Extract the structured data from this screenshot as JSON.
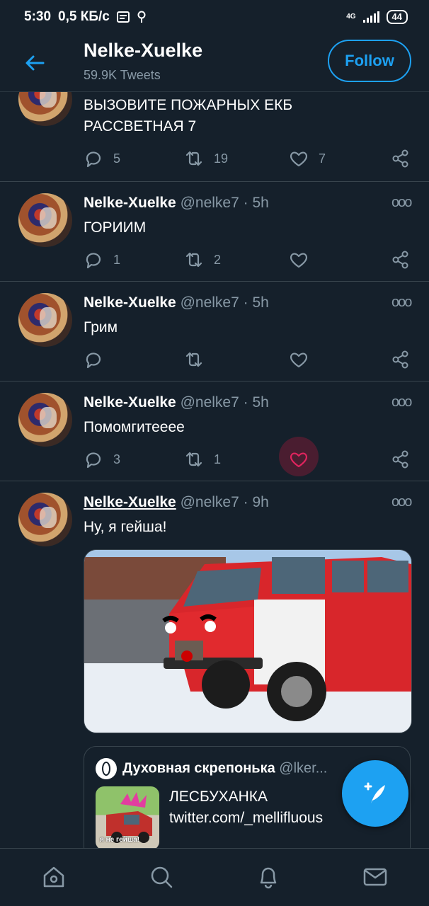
{
  "status_bar": {
    "time": "5:30",
    "speed": "0,5 КБ/с",
    "network": "4G",
    "battery": "44"
  },
  "header": {
    "title": "Nelke-Xuelke",
    "subtitle": "59.9K Tweets",
    "follow_label": "Follow"
  },
  "tweets": [
    {
      "name": "",
      "handle": "",
      "time": "",
      "text": "ВЫЗОВИТЕ ПОЖАРНЫХ ЕКБ\nРАССВЕТНАЯ 7",
      "replies": "5",
      "retweets": "19",
      "likes": "7"
    },
    {
      "name": "Nelke-Xuelke",
      "handle": "@nelke7 · 5h",
      "text": "ГОРИИМ",
      "replies": "1",
      "retweets": "2",
      "likes": ""
    },
    {
      "name": "Nelke-Xuelke",
      "handle": "@nelke7 · 5h",
      "text": "Грим",
      "replies": "",
      "retweets": "",
      "likes": ""
    },
    {
      "name": "Nelke-Xuelke",
      "handle": "@nelke7 · 5h",
      "text": "Помомгитееее",
      "replies": "3",
      "retweets": "1",
      "likes": "",
      "liked": true
    },
    {
      "name": "Nelke-Xuelke",
      "handle": "@nelke7 · 9h",
      "text": "Ну, я гейша!",
      "quote": {
        "name": "Духовная скрепонька",
        "handle": "@lker...",
        "text1": "ЛЕСБУХАНКА",
        "text2": "twitter.com/_mellifluous",
        "thumb_caption": "я не гейша!"
      }
    }
  ],
  "more_glyph": "ooo",
  "colors": {
    "background": "#15202b",
    "accent": "#1da1f2",
    "divider": "#38444d",
    "secondary_text": "#8899a6",
    "like_pink": "#e0245e"
  },
  "nav": {
    "items": [
      "home-icon",
      "search-icon",
      "notifications-icon",
      "messages-icon"
    ]
  },
  "fab": {
    "icon": "compose-feather-icon"
  }
}
